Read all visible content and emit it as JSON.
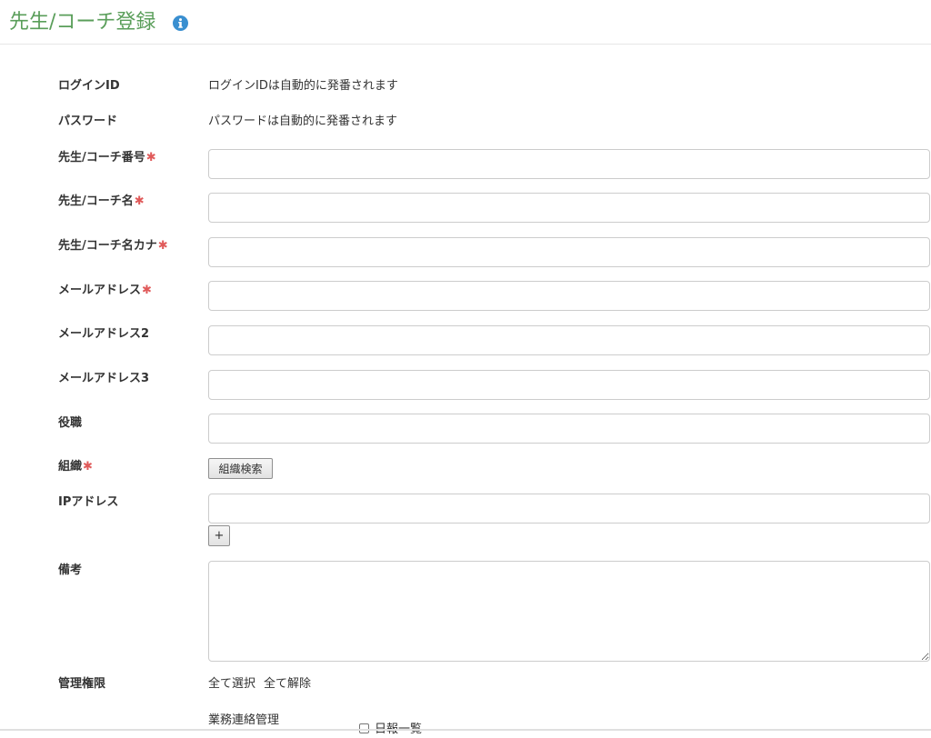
{
  "header": {
    "title": "先生/コーチ登録",
    "info_icon": "info-circle-icon",
    "title_color": "#5a9e5a",
    "icon_color": "#3a8fd0"
  },
  "form": {
    "login_id": {
      "label": "ログインID",
      "value": "ログインIDは自動的に発番されます"
    },
    "password": {
      "label": "パスワード",
      "value": "パスワードは自動的に発番されます"
    },
    "coach_number": {
      "label": "先生/コーチ番号",
      "value": "",
      "required": true
    },
    "coach_name": {
      "label": "先生/コーチ名",
      "value": "",
      "required": true
    },
    "coach_name_kana": {
      "label": "先生/コーチ名カナ",
      "value": "",
      "required": true
    },
    "email": {
      "label": "メールアドレス",
      "value": "",
      "required": true
    },
    "email2": {
      "label": "メールアドレス2",
      "value": ""
    },
    "email3": {
      "label": "メールアドレス3",
      "value": ""
    },
    "position": {
      "label": "役職",
      "value": ""
    },
    "organization": {
      "label": "組織",
      "required": true,
      "search_button": "組織検索"
    },
    "ip_address": {
      "label": "IPアドレス",
      "value": "",
      "add_button": "+"
    },
    "notes": {
      "label": "備考",
      "value": ""
    },
    "permissions": {
      "label": "管理権限",
      "select_all": "全て選択",
      "deselect_all": "全て解除",
      "groups": [
        {
          "name": "業務連絡管理",
          "items": [
            {
              "label": "日報一覧",
              "checked": false
            }
          ]
        }
      ]
    },
    "required_mark": "✱",
    "required_color": "#e05a5a"
  }
}
